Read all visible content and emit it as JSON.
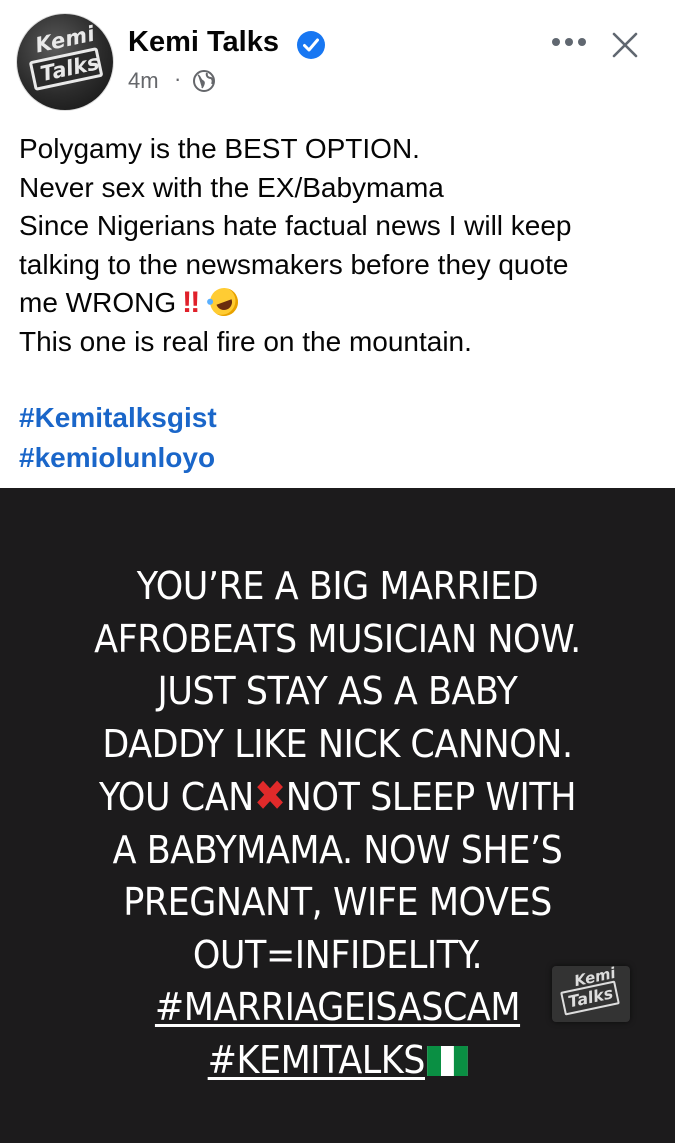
{
  "post": {
    "author": "Kemi Talks",
    "verified": true,
    "time": "4m",
    "separator": "·",
    "privacy_icon": "globe-icon",
    "avatar_logo": {
      "top": "Kemi",
      "plate": "Talks"
    },
    "text_lines": [
      "Polygamy is the BEST OPTION.",
      "Never sex with the EX/Babymama",
      "Since Nigerians hate factual news I will keep",
      "talking to the newsmakers before they quote",
      "me WRONG",
      "This one is real fire on the mountain."
    ],
    "emoji": {
      "double_exclamation": "‼",
      "laughing": "rolling-on-floor-laughing-emoji"
    },
    "hashtags": [
      "#Kemitalksgist",
      "#kemiolunloyo"
    ]
  },
  "image": {
    "caption_lines": [
      "YOU’RE A BIG MARRIED",
      "AFROBEATS MUSICIAN NOW.",
      "JUST STAY AS A BABY",
      "DADDY LIKE NICK CANNON.",
      "YOU CAN",
      "NOT SLEEP WITH",
      "A BABYMAMA. NOW SHE’S",
      "PREGNANT, WIFE MOVES",
      "OUT=INFIDELITY.",
      "#MARRIAGEISASCAM",
      "#KEMITALKS"
    ],
    "cross_mark": "✖",
    "watermark": {
      "top": "Kemi",
      "plate": "Talks"
    },
    "flag_icon": "nigeria-flag-icon"
  },
  "colors": {
    "verified": "#1877f2",
    "hashtag": "#1a66c9",
    "meta": "#65676b",
    "image_bg": "#1c1b1c",
    "cross": "#e02a2a"
  }
}
